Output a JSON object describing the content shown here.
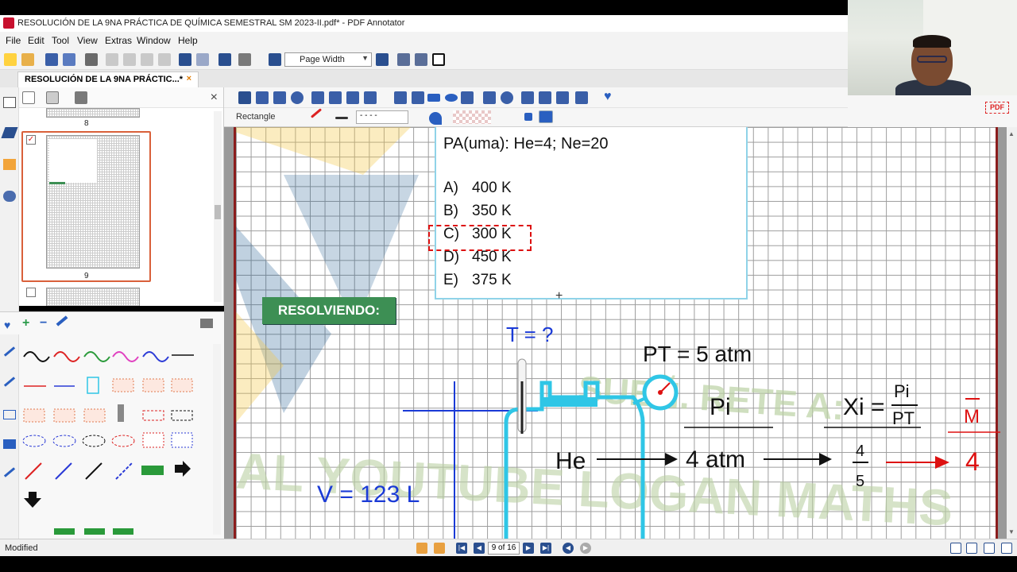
{
  "window": {
    "title": "RESOLUCIÓN DE LA 9NA PRÁCTICA DE QUÍMICA SEMESTRAL SM 2023-II.pdf* - PDF Annotator"
  },
  "menu": [
    "File",
    "Edit",
    "Tool",
    "View",
    "Extras",
    "Window",
    "Help"
  ],
  "toolbar": {
    "zoom_value": "Page Width"
  },
  "doc_tab": {
    "label": "RESOLUCIÓN DE LA 9NA PRÁCTIC...*",
    "close": "×"
  },
  "tool_options": {
    "current_tool": "Rectangle"
  },
  "thumbnails": {
    "pages": [
      "8",
      "9"
    ]
  },
  "pdf_badge": "PDF",
  "question": {
    "pa_line": "PA(uma): He=4; Ne=20",
    "options": [
      {
        "letter": "A)",
        "value": "400 K"
      },
      {
        "letter": "B)",
        "value": "350 K"
      },
      {
        "letter": "C)",
        "value": "300 K"
      },
      {
        "letter": "D)",
        "value": "450 K"
      },
      {
        "letter": "E)",
        "value": "375 K"
      }
    ]
  },
  "banner": "RESOLVIENDO:",
  "handwriting": {
    "temp": "T = ?",
    "pressure_total": "PT = 5 atm",
    "pi": "Pi",
    "xi": "Xi =",
    "xi_num": "Pi",
    "xi_den": "PT",
    "m_bar": "M",
    "volume": "V = 123 L",
    "he": "He",
    "he_pressure": "4 atm",
    "frac_num": "4",
    "frac_den": "5",
    "result": "4"
  },
  "watermark": {
    "line1": "SUEÑ. RETE A:",
    "line2": "CANAL YOUTUBE LOGAN MATHS"
  },
  "status": {
    "left": "Modified",
    "page_indicator": "9 of 16"
  },
  "colors": {
    "accent_red": "#d11111",
    "handwriting_blue": "#1a3ad6",
    "vessel_cyan": "#2fc6e6",
    "banner_green": "#3d8f54"
  }
}
